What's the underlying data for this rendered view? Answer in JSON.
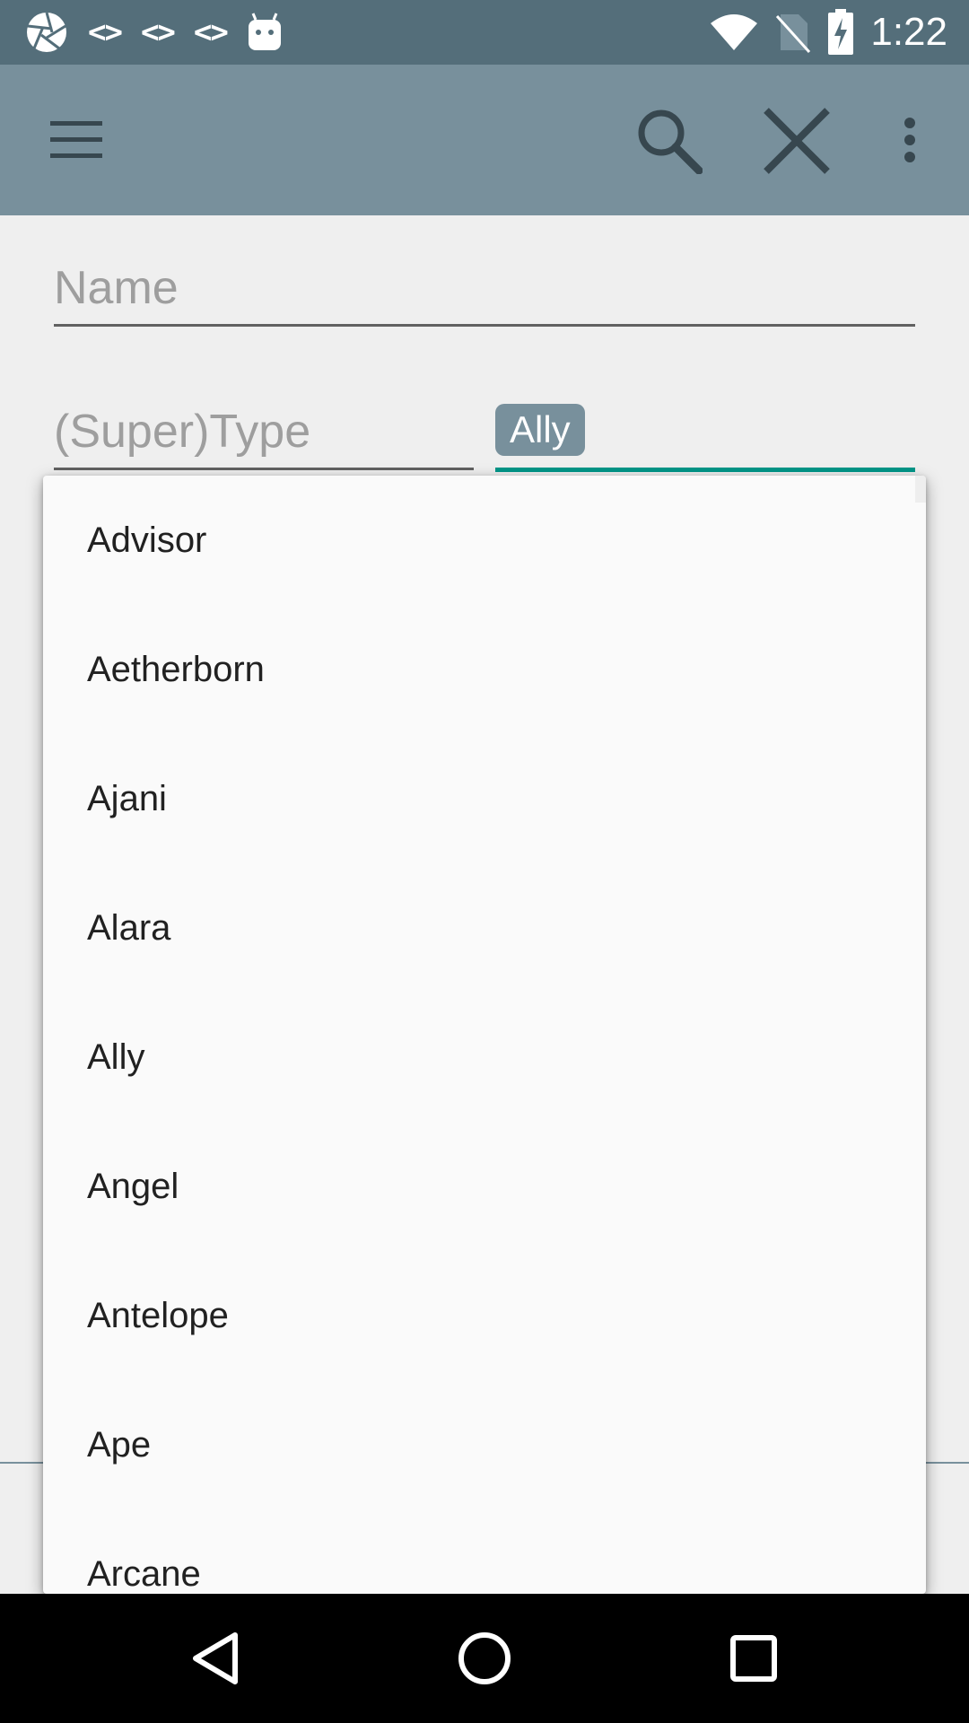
{
  "status_bar": {
    "time": "1:22",
    "left_icons": [
      "aperture-icon",
      "code-icon",
      "code-icon",
      "code-icon",
      "android-icon"
    ],
    "code_glyph": "<>",
    "right_icons": [
      "wifi-icon",
      "no-sim-icon",
      "battery-charging-icon"
    ]
  },
  "toolbar": {
    "icons": [
      "menu-icon",
      "search-icon",
      "close-icon",
      "more-vert-icon"
    ]
  },
  "form": {
    "name_hint": "Name",
    "type_hint": "(Super)Type",
    "subtype_chip": "Ally"
  },
  "dropdown": {
    "items": [
      "Advisor",
      "Aetherborn",
      "Ajani",
      "Alara",
      "Ally",
      "Angel",
      "Antelope",
      "Ape",
      "Arcane"
    ]
  },
  "nav_bar": {
    "icons": [
      "back-icon",
      "home-icon",
      "recents-icon"
    ]
  },
  "colors": {
    "status_bar": "#546e7a",
    "toolbar": "#78909c",
    "accent": "#009688",
    "chip": "#78909c"
  }
}
